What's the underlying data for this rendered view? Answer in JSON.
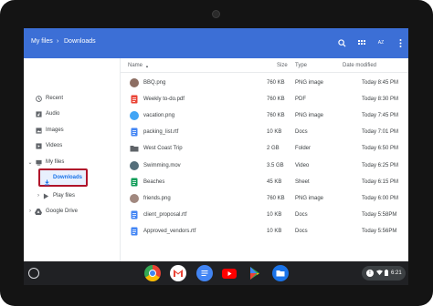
{
  "breadcrumb": {
    "root": "My files",
    "separator": "›",
    "current": "Downloads"
  },
  "toolbar": {
    "search_icon": "search-icon",
    "grid_icon": "grid-view-icon",
    "sort_icon": "sort-az-icon",
    "menu_icon": "more-vert-icon",
    "sort_label": "AZ"
  },
  "sidebar": {
    "items": [
      {
        "label": "Recent",
        "icon": "clock-icon"
      },
      {
        "label": "Audio",
        "icon": "audio-icon"
      },
      {
        "label": "Images",
        "icon": "image-icon"
      },
      {
        "label": "Videos",
        "icon": "video-icon"
      },
      {
        "label": "My files",
        "icon": "computer-icon"
      },
      {
        "label": "Downloads",
        "icon": "download-icon"
      },
      {
        "label": "Play files",
        "icon": "play-icon"
      },
      {
        "label": "Google Drive",
        "icon": "drive-icon"
      }
    ]
  },
  "columns": {
    "name": "Name",
    "sort_arrow": "▲",
    "size": "Size",
    "type": "Type",
    "date": "Date modified"
  },
  "files": [
    {
      "name": "BBQ.png",
      "size": "760 KB",
      "type": "PNG image",
      "date": "Today 8:45 PM",
      "icon": "image-thumb",
      "color": "#8d6e63"
    },
    {
      "name": "Weekly to-do.pdf",
      "size": "760 KB",
      "type": "PDF",
      "date": "Today 8:30 PM",
      "icon": "pdf-icon",
      "color": "#ea4335"
    },
    {
      "name": "vacation.png",
      "size": "760 KB",
      "type": "PNG image",
      "date": "Today 7:45 PM",
      "icon": "image-thumb",
      "color": "#42a5f5"
    },
    {
      "name": "packing_list.rtf",
      "size": "10 KB",
      "type": "Docs",
      "date": "Today 7:01 PM",
      "icon": "doc-icon",
      "color": "#4285f4"
    },
    {
      "name": "West Coast Trip",
      "size": "2 GB",
      "type": "Folder",
      "date": "Today 6:50 PM",
      "icon": "folder-icon",
      "color": "#5f6368"
    },
    {
      "name": "Swimming.mov",
      "size": "3.5 GB",
      "type": "Video",
      "date": "Today 6:25 PM",
      "icon": "video-thumb",
      "color": "#546e7a"
    },
    {
      "name": "Beaches",
      "size": "45 KB",
      "type": "Sheet",
      "date": "Today 6:15 PM",
      "icon": "sheet-icon",
      "color": "#0f9d58"
    },
    {
      "name": "friends.png",
      "size": "760 KB",
      "type": "PNG image",
      "date": "Today 6:00 PM",
      "icon": "image-thumb",
      "color": "#a1887f"
    },
    {
      "name": "client_proposal.rtf",
      "size": "10 KB",
      "type": "Docs",
      "date": "Today 5:58PM",
      "icon": "doc-icon",
      "color": "#4285f4"
    },
    {
      "name": "Approved_vendors.rtf",
      "size": "10 KB",
      "type": "Docs",
      "date": "Today 5:56PM",
      "icon": "doc-icon",
      "color": "#4285f4"
    }
  ],
  "shelf": {
    "apps": [
      "chrome-icon",
      "gmail-icon",
      "docs-icon",
      "youtube-icon",
      "play-store-icon",
      "files-icon"
    ],
    "time": "6:21"
  }
}
